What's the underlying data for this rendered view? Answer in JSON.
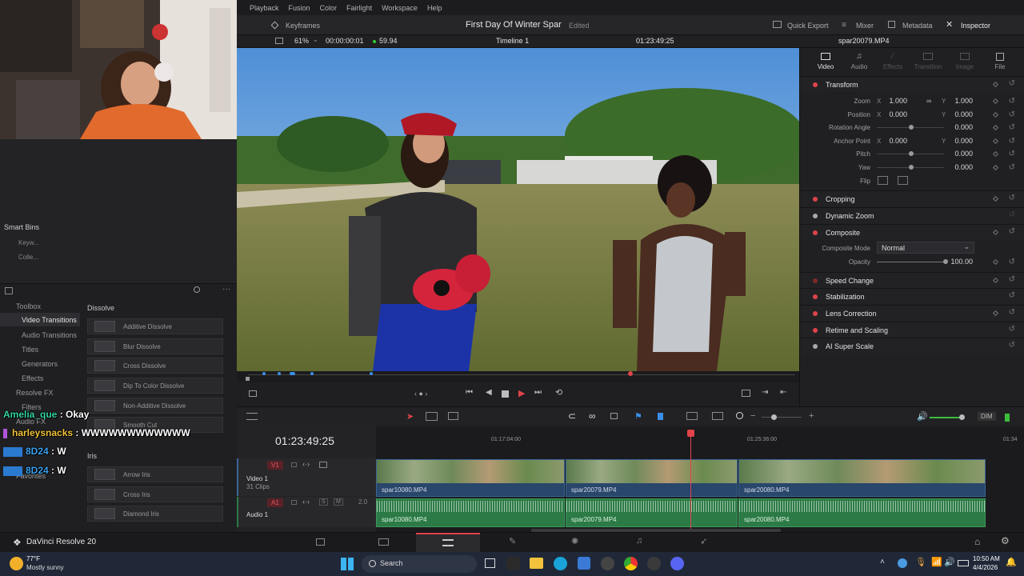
{
  "menu": [
    "Playback",
    "Fusion",
    "Color",
    "Fairlight",
    "Workspace",
    "Help"
  ],
  "toolbar": {
    "keyframes_label": "Keyframes",
    "project_title": "First Day Of Winter Spar",
    "edited_label": "Edited",
    "quick_export": "Quick Export",
    "mixer": "Mixer",
    "metadata": "Metadata",
    "inspector": "Inspector"
  },
  "viewerbar": {
    "zoom": "61%",
    "src_timecode": "00:00:00:01",
    "fps": "59.94",
    "timeline_name": "Timeline 1",
    "timecode": "01:23:49:25",
    "clip_name": "spar20079.MP4"
  },
  "left": {
    "smart_bins": "Smart Bins",
    "keywords": "Keyw...",
    "collections": "Colle...",
    "tree": [
      "Toolbox",
      "Video Transitions",
      "Audio Transitions",
      "Titles",
      "Generators",
      "Effects",
      "Resolve FX",
      "Filters",
      "Audio FX",
      "Favorites"
    ],
    "dissolve_header": "Dissolve",
    "dissolves": [
      "Additive Dissolve",
      "Blur Dissolve",
      "Cross Dissolve",
      "Dip To Color Dissolve",
      "Non-Additive Dissolve",
      "Smooth Cut"
    ],
    "iris_header": "Iris",
    "iris": [
      "Arrow Iris",
      "Cross Iris",
      "Diamond Iris"
    ]
  },
  "chat": [
    {
      "user": "Amelia_que",
      "msg": " : Okay",
      "color": "#34d3a4"
    },
    {
      "user": "harleysnacks",
      "msg": " : WWWWWWWWWWWW",
      "color": "#f0c23a"
    },
    {
      "user": "8D24",
      "msg": " : W",
      "color": "#3aa3f0"
    },
    {
      "user": "8D24",
      "msg": " : W",
      "color": "#3aa3f0"
    }
  ],
  "inspector": {
    "tabs": [
      "Video",
      "Audio",
      "Effects",
      "Transition",
      "Image",
      "File"
    ],
    "transform": "Transform",
    "props": [
      {
        "label": "Zoom",
        "x": "1.000",
        "y": "1.000"
      },
      {
        "label": "Position",
        "x": "0.000",
        "y": "0.000"
      },
      {
        "label": "Rotation Angle",
        "v": "0.000"
      },
      {
        "label": "Anchor Point",
        "x": "0.000",
        "y": "0.000"
      },
      {
        "label": "Pitch",
        "v": "0.000"
      },
      {
        "label": "Yaw",
        "v": "0.000"
      },
      {
        "label": "Flip"
      }
    ],
    "sections": [
      "Cropping",
      "Dynamic Zoom",
      "Composite",
      "Speed Change",
      "Stabilization",
      "Lens Correction",
      "Retime and Scaling",
      "AI Super Scale"
    ],
    "composite_mode_label": "Composite Mode",
    "composite_mode_value": "Normal",
    "opacity_label": "Opacity",
    "opacity_value": "100.00"
  },
  "timeline": {
    "timecode": "01:23:49:25",
    "ruler": [
      "01:17:04:00",
      "01:25:36:00",
      "01:34"
    ],
    "v1": "V1",
    "video1": "Video 1",
    "clips_count": "31 Clips",
    "a1": "A1",
    "audio1": "Audio 1",
    "audio_level": "2.0",
    "clips": [
      "spar10080.MP4",
      "spar20079.MP4",
      "spar20080.MP4"
    ],
    "dim": "DIM"
  },
  "app": {
    "name": "DaVinci Resolve 20"
  },
  "taskbar": {
    "weather_temp": "77°F",
    "weather_desc": "Mostly sunny",
    "search": "Search",
    "time": "10:50 AM",
    "date": "4/4/2026"
  }
}
